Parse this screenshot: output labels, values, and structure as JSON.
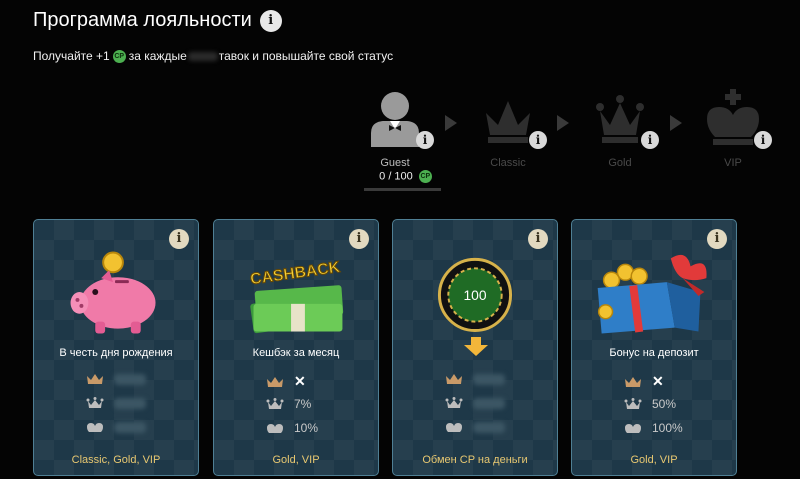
{
  "header": {
    "title": "Программа лояльности",
    "subtitle_prefix": "Получайте +1",
    "cp_label": "CP",
    "subtitle_middle": "за каждые",
    "subtitle_suffix": "тавок и повышайте свой статус"
  },
  "statuses": [
    {
      "name": "Guest",
      "active": true,
      "icon": "guest-avatar-icon"
    },
    {
      "name": "Classic",
      "active": false,
      "icon": "crown-icon"
    },
    {
      "name": "Gold",
      "active": false,
      "icon": "royal-crown-icon"
    },
    {
      "name": "VIP",
      "active": false,
      "icon": "king-crown-icon"
    }
  ],
  "progress": {
    "current": 0,
    "total": 100,
    "text": "0 / 100",
    "cp_label": "CP"
  },
  "cards": [
    {
      "name": "В честь дня рождения",
      "icon": "piggy-bank-icon",
      "rows": [
        {
          "level": "Classic",
          "value": ""
        },
        {
          "level": "Gold",
          "value": ""
        },
        {
          "level": "VIP",
          "value": ""
        }
      ],
      "levels": "Classic, Gold, VIP"
    },
    {
      "name": "Кешбэк за месяц",
      "icon": "cashback-money-icon",
      "badge": "CASHBACK",
      "rows": [
        {
          "level": "Classic",
          "value": "✕"
        },
        {
          "level": "Gold",
          "value": "7%"
        },
        {
          "level": "VIP",
          "value": "10%"
        }
      ],
      "levels": "Gold, VIP"
    },
    {
      "name": "",
      "icon": "cp-coin-icon",
      "coin_value": "100",
      "rows": [
        {
          "level": "Classic",
          "value": ""
        },
        {
          "level": "Gold",
          "value": ""
        },
        {
          "level": "VIP",
          "value": ""
        }
      ],
      "levels": "Обмен CP на деньги"
    },
    {
      "name": "Бонус на депозит",
      "icon": "gift-box-icon",
      "rows": [
        {
          "level": "Classic",
          "value": "✕"
        },
        {
          "level": "Gold",
          "value": "50%"
        },
        {
          "level": "VIP",
          "value": "100%"
        }
      ],
      "levels": "Gold, VIP"
    }
  ],
  "colors": {
    "background": "#040404",
    "card": "#1e3848",
    "card_border": "#4f7f94",
    "gold_text": "#e8c871",
    "cp_green": "#4caf50"
  }
}
